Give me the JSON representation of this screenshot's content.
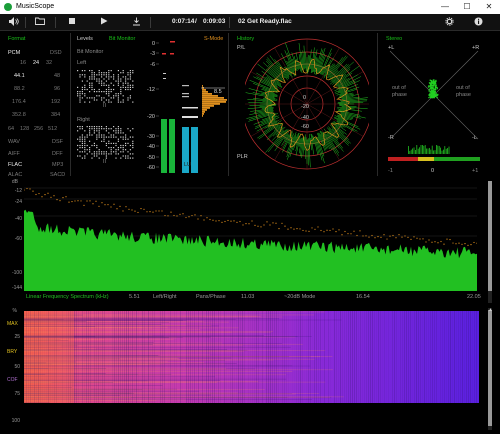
{
  "window": {
    "title": "MusicScope",
    "minimize": "—",
    "maximize": "☐",
    "close": "✕"
  },
  "toolbar": {
    "icons": [
      "volume-icon",
      "folder-icon",
      "stop-icon",
      "play-icon",
      "export-icon",
      "settings-icon",
      "info-icon"
    ],
    "elapsed": "0:07:14",
    "divider": "/",
    "total": "0:09:03",
    "track": "02 Get Ready.flac"
  },
  "format": {
    "title": "Format",
    "header_left": "PCM",
    "header_right": "DSD",
    "bit_depths": [
      "16",
      "24",
      "32"
    ],
    "rates": [
      {
        "left": "44.1",
        "right": "48"
      },
      {
        "left": "88.2",
        "right": "96"
      },
      {
        "left": "176.4",
        "right": "192"
      },
      {
        "left": "352.8",
        "right": "384"
      }
    ],
    "dsd_rates": [
      "64",
      "128",
      "256",
      "512"
    ],
    "containers": [
      {
        "left": "WAV",
        "right": "DSF"
      },
      {
        "left": "AIFF",
        "right": "DFF"
      },
      {
        "left": "FLAC",
        "right": "MP3"
      },
      {
        "left": "ALAC",
        "right": "SACD"
      }
    ],
    "active": [
      "44.1",
      "24",
      "FLAC"
    ]
  },
  "levels": {
    "title": "Levels",
    "bitmonitor": "Bit Monitor",
    "bitmonitor_sub": "Bit Monitor",
    "left": "Left",
    "right": "Right",
    "left_markers": "II",
    "right_markers": "II",
    "bar_ticks": [
      "0",
      "-3",
      "-6",
      "-12",
      "-20",
      "-30",
      "-40",
      "-50",
      "-60"
    ],
    "smode": "S-Mode",
    "peak_value": "8.5",
    "lu_label": "LU"
  },
  "history": {
    "title": "History",
    "pl": "P/L",
    "plr": "PLR",
    "rings": [
      "0",
      "-20",
      "-40",
      "-60"
    ]
  },
  "stereo": {
    "title": "Stereo",
    "plus_l": "+L",
    "plus_r": "+R",
    "minus_r": "-R",
    "minus_l": "-L",
    "out_phase_left": "out of phase",
    "out_phase_right": "out of phase",
    "corr_ticks": [
      "-1",
      "0",
      "+1"
    ]
  },
  "spectrum": {
    "ylabels": [
      "dB",
      "-12",
      "-24",
      "-40",
      "-60",
      "-100",
      "-144"
    ],
    "xlabel": "Linear Frequency Spectrum (kHz)",
    "xticks": [
      "5.51",
      "11.03",
      "16.54",
      "22.05"
    ],
    "modes": [
      "Left/Right",
      "Pans/Phase",
      "~20dB Mode"
    ],
    "accent_green": "#22c022",
    "accent_orange": "#e0901e"
  },
  "sonogram": {
    "ylabels": [
      "%",
      "25",
      "50",
      "75",
      "100"
    ],
    "side_labels": [
      "MAX",
      "BRY",
      "COF"
    ],
    "scroll_label": "▲"
  }
}
